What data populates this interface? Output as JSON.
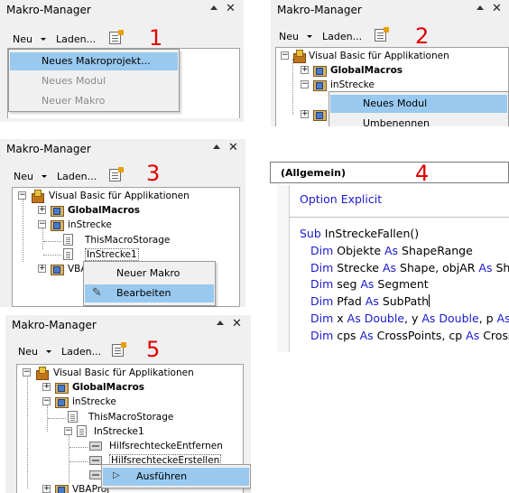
{
  "panels": [
    {
      "title": "Makro-Manager",
      "toolbar": {
        "new_label": "Neu",
        "load_label": "Laden..."
      },
      "step": "1",
      "menu": [
        {
          "label": "Neues Makroprojekt...",
          "enabled": true,
          "selected": true
        },
        {
          "label": "Neues Modul",
          "enabled": false,
          "selected": false
        },
        {
          "label": "Neuer Makro",
          "enabled": false,
          "selected": false
        }
      ]
    },
    {
      "title": "Makro-Manager",
      "toolbar": {
        "new_label": "Neu",
        "load_label": "Laden..."
      },
      "step": "2",
      "tree": [
        {
          "label": "Visual Basic für Applikationen",
          "bold": false
        },
        {
          "label": "GlobalMacros",
          "bold": true
        },
        {
          "label": "inStrecke",
          "bold": false
        }
      ],
      "menu": [
        {
          "label": "Neues Modul",
          "enabled": true,
          "selected": true
        },
        {
          "label": "Umbenennen",
          "enabled": true,
          "selected": false
        }
      ]
    },
    {
      "title": "Makro-Manager",
      "toolbar": {
        "new_label": "Neu",
        "load_label": "Laden..."
      },
      "step": "3",
      "tree": [
        {
          "label": "Visual Basic für Applikationen",
          "bold": false
        },
        {
          "label": "GlobalMacros",
          "bold": true
        },
        {
          "label": "inStrecke",
          "bold": false
        },
        {
          "label": "ThisMacroStorage",
          "bold": false
        },
        {
          "label": "InStrecke1",
          "bold": false
        },
        {
          "label": "VBA",
          "bold": false
        }
      ],
      "menu": [
        {
          "label": "Neuer Makro",
          "enabled": true,
          "selected": false,
          "icon": ""
        },
        {
          "label": "Bearbeiten",
          "enabled": true,
          "selected": true,
          "icon": "edit-pencil-icon"
        }
      ]
    },
    {
      "step": "4",
      "combo_label": "(Allgemein)",
      "code": [
        "Option Explicit",
        "",
        "Sub InStreckeFallen()",
        "    Dim Objekte As ShapeRange",
        "    Dim Strecke As Shape, objAR As Sha",
        "    Dim seg As Segment",
        "    Dim Pfad As SubPath",
        "    Dim x As Double, y As Double, p As D",
        "    Dim cps As CrossPoints, cp As CrossP"
      ]
    },
    {
      "title": "Makro-Manager",
      "toolbar": {
        "new_label": "Neu",
        "load_label": "Laden..."
      },
      "step": "5",
      "tree": [
        {
          "label": "Visual Basic für Applikationen",
          "bold": false
        },
        {
          "label": "GlobalMacros",
          "bold": true
        },
        {
          "label": "inStrecke",
          "bold": false
        },
        {
          "label": "ThisMacroStorage",
          "bold": false
        },
        {
          "label": "InStrecke1",
          "bold": false
        },
        {
          "label": "HilfsrechteckeEntfernen",
          "bold": false
        },
        {
          "label": "HilfsrechteckeErstellen",
          "bold": false
        },
        {
          "label": "VBAProj",
          "bold": false
        }
      ],
      "menu": [
        {
          "label": "Ausführen",
          "enabled": true,
          "selected": true,
          "icon": "play-triangle-icon"
        }
      ]
    }
  ]
}
